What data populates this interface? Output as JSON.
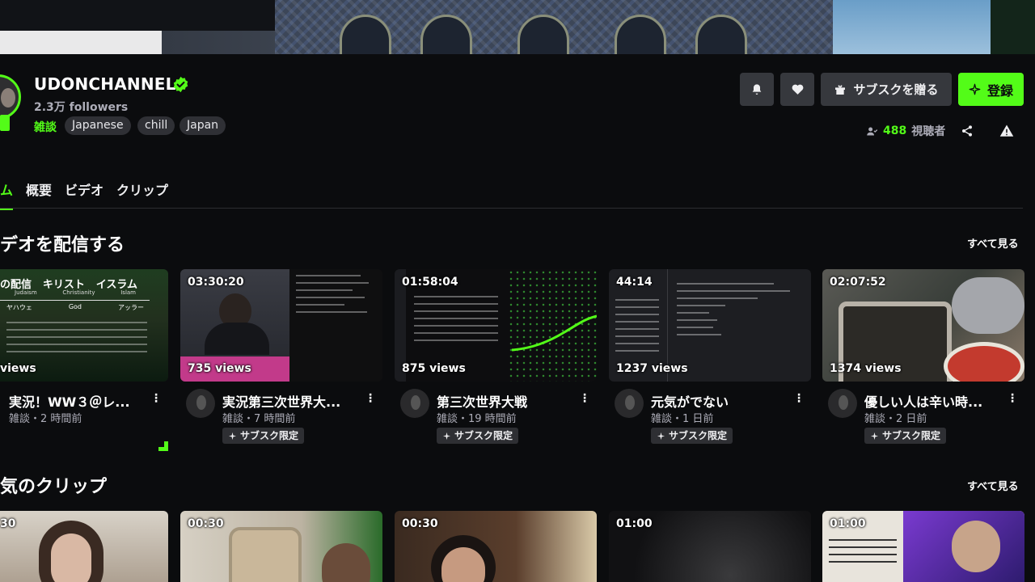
{
  "channel": {
    "name": "UDONCHANNEL",
    "followers": "2.3万 followers",
    "category": "雑談",
    "tags": [
      "Japanese",
      "chill",
      "Japan"
    ],
    "viewers_count": "488",
    "viewers_label": "視聴者",
    "accent_color": "#53fc18"
  },
  "actions": {
    "notify_icon": "bell-icon",
    "follow_icon": "heart-icon",
    "gift_sub_label": "サブスクを贈る",
    "subscribe_label": "登録"
  },
  "tabs": [
    "ム",
    "概要",
    "ビデオ",
    "クリップ"
  ],
  "sections": {
    "videos_title": "デオを配信する",
    "clips_title": "気のクリップ",
    "see_all": "すべて見る"
  },
  "videos": [
    {
      "duration": "",
      "views": "views",
      "title": "実況！WW３＠レ...",
      "meta": "雑談・2 時間前",
      "badge": ""
    },
    {
      "duration": "03:30:20",
      "views": "735 views",
      "title": "実況第三次世界大...",
      "meta": "雑談・7 時間前",
      "badge": "サブスク限定"
    },
    {
      "duration": "01:58:04",
      "views": "875 views",
      "title": "第三次世界大戦",
      "meta": "雑談・19 時間前",
      "badge": "サブスク限定"
    },
    {
      "duration": "44:14",
      "views": "1237 views",
      "title": "元気がでない",
      "meta": "雑談・1 日前",
      "badge": "サブスク限定"
    },
    {
      "duration": "02:07:52",
      "views": "1374 views",
      "title": "優しい人は辛い時...",
      "meta": "雑談・2 日前",
      "badge": "サブスク限定"
    }
  ],
  "thumb_text": {
    "v1_head": [
      "の配信",
      "キリスト",
      "イスラム"
    ],
    "v1_sub": [
      "Judaism",
      "Christianity",
      "Islam"
    ],
    "v1_row1": [
      "ヤハウェ",
      "God",
      "アッラー"
    ]
  },
  "clips": [
    {
      "duration": "30"
    },
    {
      "duration": "00:30"
    },
    {
      "duration": "00:30"
    },
    {
      "duration": "01:00"
    },
    {
      "duration": "01:00"
    }
  ]
}
